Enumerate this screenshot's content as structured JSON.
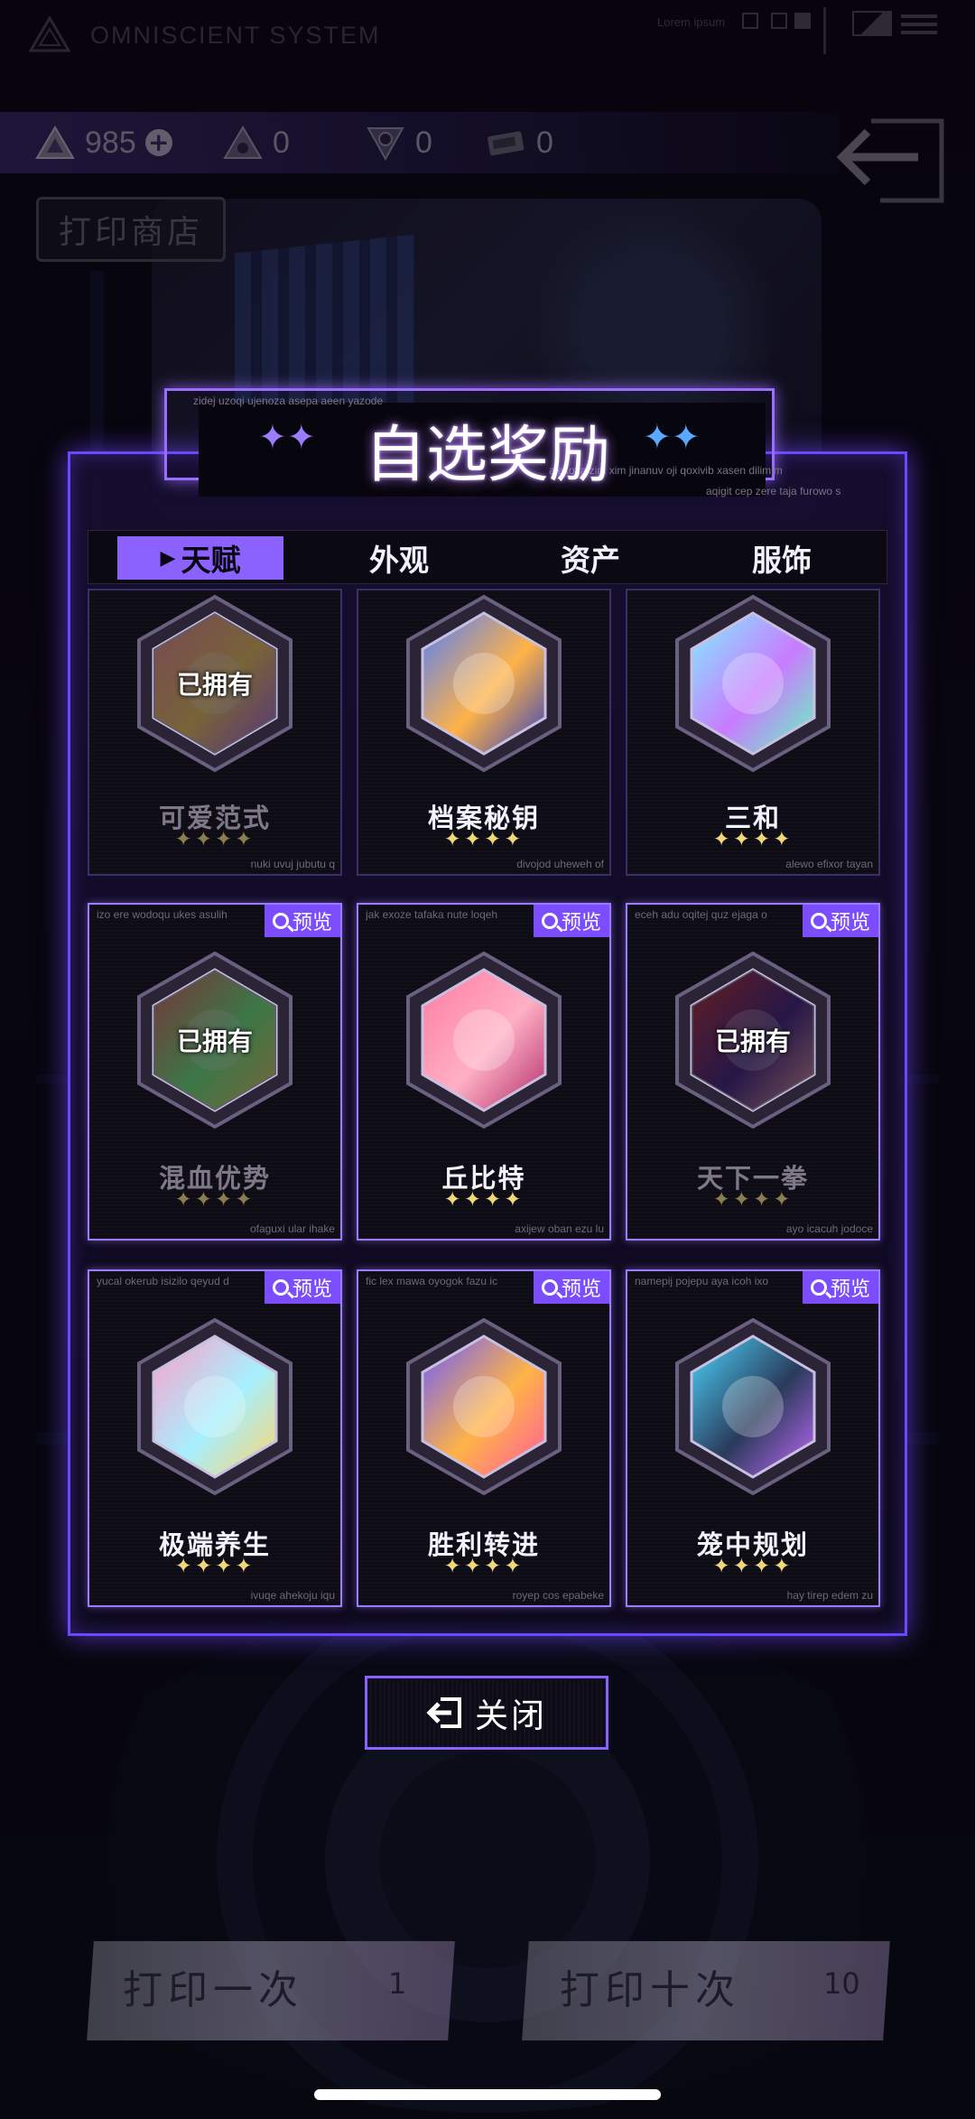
{
  "system": {
    "title": "OMNISCIENT SYSTEM",
    "tag": "Lorem ipsum"
  },
  "currencies": [
    {
      "icon": "triangle-gem-icon",
      "value": "985",
      "has_add": true
    },
    {
      "icon": "triangle-gem-outline-icon",
      "value": "0"
    },
    {
      "icon": "chip-triangle-icon",
      "value": "0"
    },
    {
      "icon": "ticket-icon",
      "value": "0"
    }
  ],
  "shop_label": "打印商店",
  "modal": {
    "title": "自选奖励",
    "micro_left": "zidej uzoqi ujenoza asepa aeen yazode",
    "micro_right_1": "alekoya zim xim jinanuv oji qoxivib xasen dilimim",
    "micro_right_2": "aqigit cep zere taja furowo s",
    "tabs": [
      {
        "label": "天赋",
        "active": true
      },
      {
        "label": "外观",
        "active": false
      },
      {
        "label": "资产",
        "active": false
      },
      {
        "label": "服饰",
        "active": false
      }
    ],
    "preview_label": "预览",
    "owned_label": "已拥有",
    "stars": "✦✦✦✦",
    "cards": [
      {
        "name": "可爱范式",
        "owned": true,
        "preview": false,
        "code_top": "",
        "code_bottom": "nuki uvuj jubutu q",
        "art": "cute"
      },
      {
        "name": "档案秘钥",
        "owned": false,
        "preview": false,
        "code_top": "",
        "code_bottom": "divojod uheweh of",
        "art": "key"
      },
      {
        "name": "三和",
        "owned": false,
        "preview": false,
        "code_top": "",
        "code_bottom": "alewo efixor tayan",
        "art": "lotus"
      },
      {
        "name": "混血优势",
        "owned": true,
        "preview": true,
        "code_top": "izo ere wodoqu ukes asulih",
        "code_bottom": "ofaguxi ular ihake",
        "art": "mixed"
      },
      {
        "name": "丘比特",
        "owned": false,
        "preview": true,
        "code_top": "jak exoze tafaka nute loqeh",
        "code_bottom": "axijew oban ezu lu",
        "art": "cupid"
      },
      {
        "name": "天下一拳",
        "owned": true,
        "preview": true,
        "code_top": "eceh adu oqitej quz ejaga o",
        "code_bottom": "ayo icacuh jodoce",
        "art": "fist"
      },
      {
        "name": "极端养生",
        "owned": false,
        "preview": true,
        "code_top": "yucal okerub isizilo qeyud d",
        "code_bottom": "ivuqe ahekoju iqu",
        "art": "capybara"
      },
      {
        "name": "胜利转进",
        "owned": false,
        "preview": true,
        "code_top": "fic lex mawa oyogok fazu ic",
        "code_bottom": "royep cos epabeke",
        "art": "victory"
      },
      {
        "name": "笼中规划",
        "owned": false,
        "preview": true,
        "code_top": "namepij pojepu aya icoh ixo",
        "code_bottom": "hay tirep edem zu",
        "art": "cage"
      }
    ]
  },
  "close_label": "关闭",
  "print_once": {
    "label": "打印一次",
    "count": "1"
  },
  "print_ten": {
    "label": "打印十次",
    "count": "10"
  },
  "colors": {
    "accent": "#8c62ff",
    "modal_border": "#6a48ff",
    "preview_badge": "#7b4dff",
    "star": "#f0d77a"
  }
}
